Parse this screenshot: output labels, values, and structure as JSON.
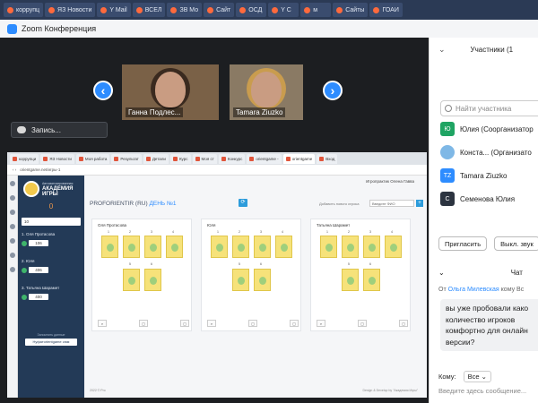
{
  "os_tabs": [
    "коррупц",
    "ЯЗ Новости",
    "Y Mail",
    "ВСЕЛ",
    "ЗВ Мо",
    "Сайт",
    "ОСД",
    "Y С",
    "м",
    "Сайты",
    "ГОАИ"
  ],
  "zoom": {
    "title": "Zoom Конференция",
    "record_label": "Запись...",
    "videos": [
      {
        "name": "Ганна Подлес..."
      },
      {
        "name": "Tamara Ziuzko"
      }
    ],
    "nav_prev": "‹",
    "nav_next": "›"
  },
  "shared_screen": {
    "browser_tabs": [
      "коррупци",
      "ЯЗ Новости",
      "Моя работа",
      "Результат",
      "Детали",
      "Курс",
      "Моя ст",
      "Конкурс",
      "orientgame - ",
      "orientgame",
      "Вход"
    ],
    "url": "orientgame.net/игры-1",
    "user_line": "Игропрактик Олена Гавва",
    "sidebar": {
      "academy_small": "Автоматизированная",
      "academy_title_1": "АКАДЕМИЯ",
      "academy_title_2": "ИГРЫ",
      "score": "0",
      "input_value": "10",
      "players": [
        {
          "name": "1. Оля Протасова",
          "value": "106"
        },
        {
          "name": "2. Юля",
          "value": "406"
        },
        {
          "name": "3. Татьяна Шарамет",
          "value": "400"
        }
      ],
      "hint": "Запомнить данные",
      "button": "Нуфатоrientgame сюм"
    },
    "game_title_prefix": "PROFORIENTIR (RU)",
    "game_title_day": "ДЕНЬ №1",
    "add_label": "Добавить нового игрока",
    "add_input_placeholder": "Введите ФИО",
    "add_button": "+",
    "refresh_button": "⟳",
    "boards": [
      {
        "name": "Оля Протасова",
        "numbers": [
          "1",
          "2",
          "3",
          "4",
          "5",
          "6"
        ]
      },
      {
        "name": "Юля",
        "numbers": [
          "1",
          "2",
          "3",
          "4",
          "5",
          "6"
        ]
      },
      {
        "name": "Татьяна Шарамет",
        "numbers": [
          "1",
          "2",
          "3",
          "4",
          "5",
          "6"
        ]
      }
    ],
    "footer_left": "2022 © Pro",
    "footer_right": "Design & Develop by \"Академия Игры\""
  },
  "participants_panel": {
    "title": "Участники (1",
    "search_placeholder": "Найти участника",
    "participants": [
      {
        "initials": "Ю",
        "name": "Юлия (Соорганизатор",
        "color": "#1fa463"
      },
      {
        "initials": "",
        "name": "Конста... (Организато",
        "color": "#7fb8e6"
      },
      {
        "initials": "TZ",
        "name": "Tamara Ziuzko",
        "color": "#2d8cff"
      },
      {
        "initials": "С",
        "name": "Семенова Юлия",
        "color": "#2c3440"
      }
    ],
    "invite_button": "Пригласить",
    "mute_button": "Выкл. звук"
  },
  "chat": {
    "title": "Чат",
    "from_prefix": "От",
    "from_name": "Ольга Милевская",
    "from_to": "кому Вс",
    "message": "вы уже пробовали како количество игроков комфортно для онлайн версии?",
    "to_label": "Кому:",
    "to_value": "Все",
    "input_placeholder": "Введите здесь сообщение..."
  }
}
